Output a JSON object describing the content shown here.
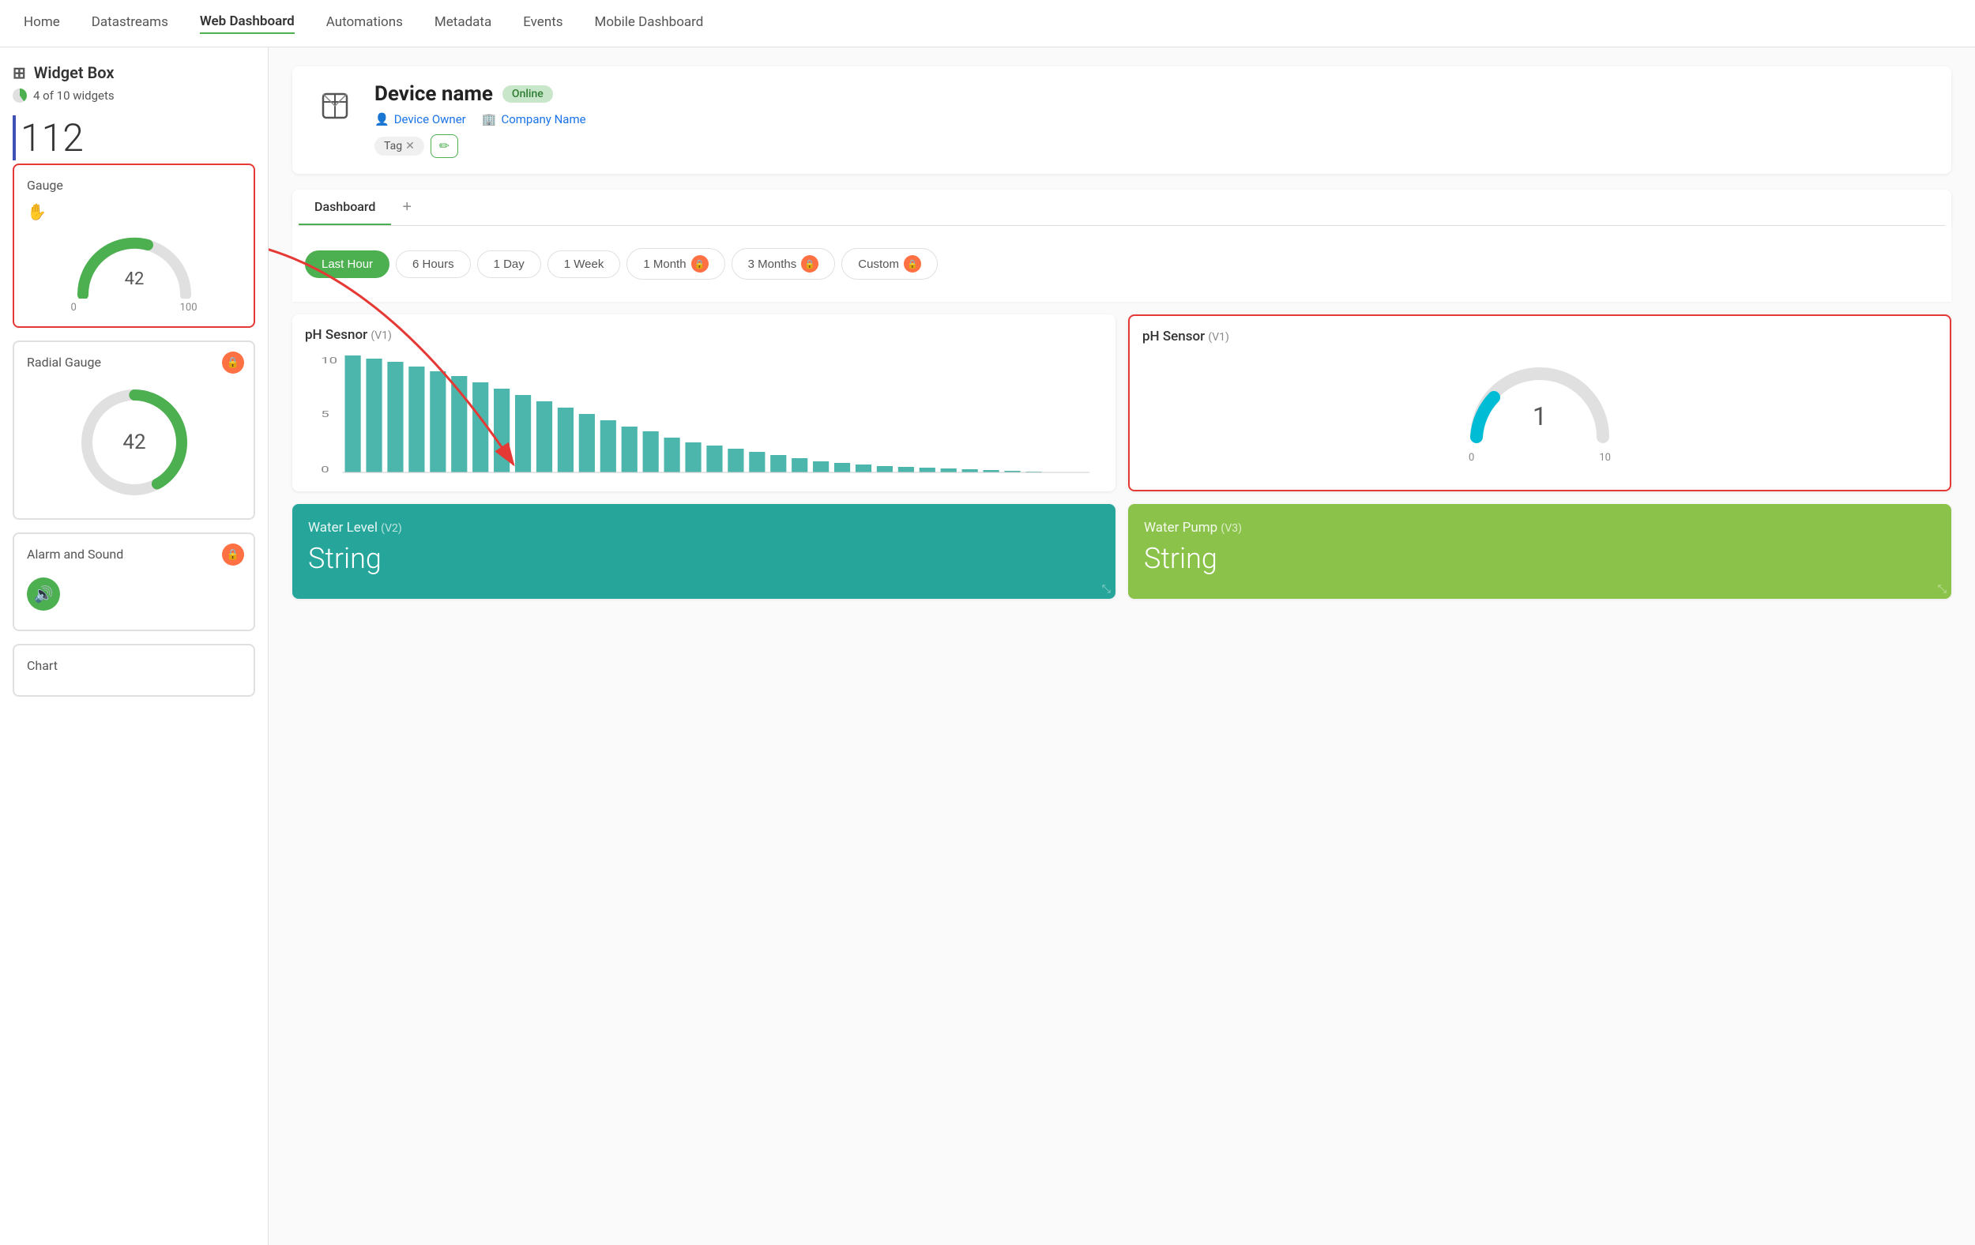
{
  "nav": {
    "items": [
      "Home",
      "Datastreams",
      "Web Dashboard",
      "Automations",
      "Metadata",
      "Events",
      "Mobile Dashboard"
    ],
    "active": "Web Dashboard"
  },
  "sidebar": {
    "title": "Widget Box",
    "title_icon": "🗂",
    "widget_count": "4 of 10 widgets",
    "number": "112",
    "widgets": [
      {
        "name": "Gauge",
        "selected": true,
        "value": 42,
        "min": 0,
        "max": 100,
        "has_lock": false
      },
      {
        "name": "Radial Gauge",
        "selected": false,
        "value": 42,
        "min": null,
        "max": null,
        "has_lock": true
      },
      {
        "name": "Alarm and Sound",
        "selected": false,
        "value": null,
        "has_lock": true
      },
      {
        "name": "Chart",
        "selected": false,
        "value": null,
        "has_lock": false
      }
    ]
  },
  "device": {
    "name": "Device name",
    "status": "Online",
    "owner": "Device Owner",
    "company": "Company Name",
    "tag": "Tag"
  },
  "tabs": [
    {
      "label": "Dashboard",
      "active": true
    },
    {
      "label": "+",
      "active": false
    }
  ],
  "time_ranges": [
    {
      "label": "Last Hour",
      "active": true,
      "has_lock": false
    },
    {
      "label": "6 Hours",
      "active": false,
      "has_lock": false
    },
    {
      "label": "1 Day",
      "active": false,
      "has_lock": false
    },
    {
      "label": "1 Week",
      "active": false,
      "has_lock": false
    },
    {
      "label": "1 Month",
      "active": false,
      "has_lock": true
    },
    {
      "label": "3 Months",
      "active": false,
      "has_lock": true
    },
    {
      "label": "Custom",
      "active": false,
      "has_lock": true
    }
  ],
  "widgets": {
    "chart": {
      "title": "pH Sesnor",
      "v_label": "(V1)"
    },
    "gauge": {
      "title": "pH Sensor",
      "v_label": "(V1)",
      "value": 1,
      "min": 0,
      "max": 10
    },
    "water_level": {
      "title": "Water Level",
      "v_label": "(V2)",
      "value": "String"
    },
    "water_pump": {
      "title": "Water Pump",
      "v_label": "(V3)",
      "value": "String"
    }
  }
}
